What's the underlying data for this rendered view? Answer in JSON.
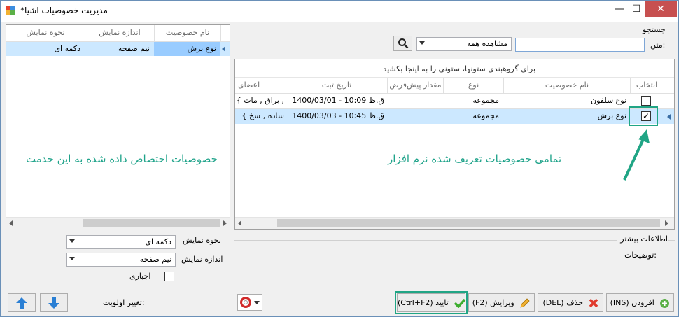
{
  "window": {
    "title": "*مدیریت خصوصیات اشیا",
    "minimize": "—",
    "maximize": "☐",
    "close": "✕"
  },
  "left_grid": {
    "columns": [
      "نام خصوصیت",
      "اندازه نمایش",
      "نحوه نمایش"
    ],
    "rows": [
      {
        "name": "نوع برش",
        "size": "نیم صفحه",
        "mode": "دکمه ای"
      }
    ],
    "note": "خصوصیات اختصاص داده شده به این خدمت"
  },
  "search": {
    "group_label": "جستجو",
    "text_label": "متن:",
    "text_value": "",
    "view_value": "مشاهده همه"
  },
  "right_grid": {
    "group_hint": "برای گروهبندی ستونها، ستونی را به اینجا بکشید",
    "columns": [
      "انتخاب",
      "نام خصوصیت",
      "نوع",
      "مقدار پیش‌فرض",
      "تاریخ ثبت",
      "اعضای"
    ],
    "rows": [
      {
        "checked": false,
        "name": "نوع سلفون",
        "type": "مجموعه",
        "default": "",
        "date": "1400/03/01 - 10:09 ق.ظ",
        "members": "{ براق , مات ,"
      },
      {
        "checked": true,
        "name": "نوع برش",
        "type": "مجموعه",
        "default": "",
        "date": "1400/03/03 - 10:45 ق.ظ",
        "members": "{ ساده , سخ"
      }
    ],
    "note": "تمامی خصوصیات تعریف شده نرم افزار"
  },
  "more_info": {
    "label": "اطلاعات بیشتر",
    "desc_label": "توضیحات:"
  },
  "display_props": {
    "mode_label": "نحوه نمایش",
    "mode_value": "دکمه ای",
    "size_label": "اندازه نمایش",
    "size_value": "نیم صفحه",
    "required_label": "اجباری"
  },
  "priority_label": "تغییر اولویت:",
  "buttons": {
    "add": "(INS) افزودن",
    "delete": "(DEL) حذف",
    "edit": "(F2) ویرایش",
    "confirm": "(Ctrl+F2) تایید"
  },
  "colors": {
    "accent": "#20a585",
    "selection": "#cce8ff",
    "note_text": "#1fa38a"
  }
}
